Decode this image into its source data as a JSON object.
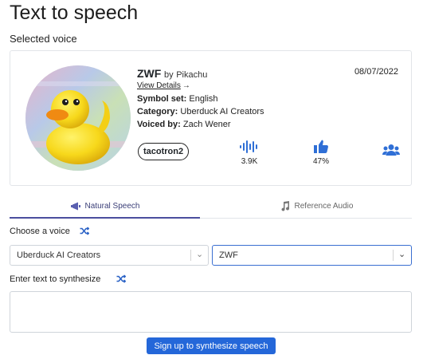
{
  "page": {
    "title": "Text to speech",
    "selected_voice_label": "Selected voice"
  },
  "voice": {
    "name": "ZWF",
    "by_prefix": "by",
    "by": "Pikachu",
    "view_details": "View Details",
    "view_details_arrow": "→",
    "symbol_set_label": "Symbol set:",
    "symbol_set": "English",
    "category_label": "Category:",
    "category": "Uberduck AI Creators",
    "voiced_by_label": "Voiced by:",
    "voiced_by": "Zach Wener",
    "date": "08/07/2022",
    "model": "tacotron2",
    "stats": {
      "uses": "3.9K",
      "rating": "47%"
    }
  },
  "tabs": [
    {
      "label": "Natural Speech",
      "icon": "megaphone-icon",
      "active": true
    },
    {
      "label": "Reference Audio",
      "icon": "music-note-icon",
      "active": false
    }
  ],
  "form": {
    "choose_voice_label": "Choose a voice",
    "category_select_value": "Uberduck AI Creators",
    "voice_select_value": "ZWF",
    "enter_text_label": "Enter text to synthesize",
    "textarea_placeholder": "",
    "submit_label": "Sign up to synthesize speech"
  },
  "colors": {
    "accent": "#2467d9",
    "tab_active": "#4b4e9e",
    "shuffle": "#2c63c6"
  }
}
